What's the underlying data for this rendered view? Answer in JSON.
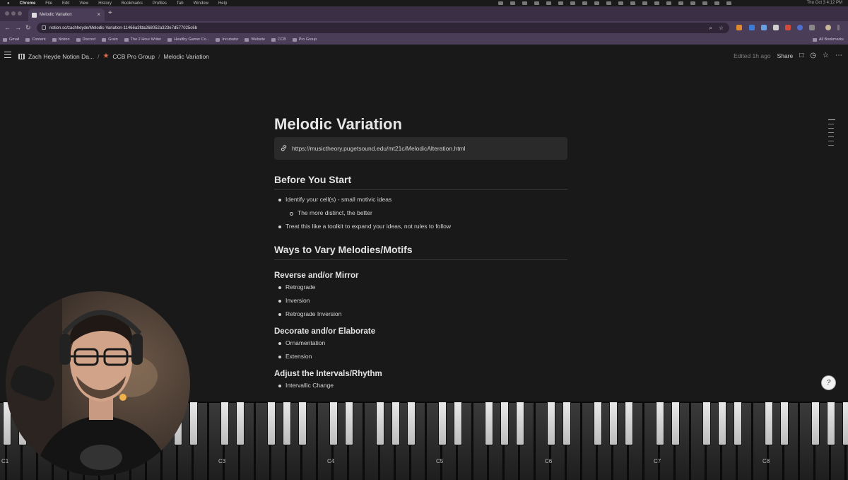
{
  "menubar": {
    "app": "Chrome",
    "items": [
      "File",
      "Edit",
      "View",
      "History",
      "Bookmarks",
      "Profiles",
      "Tab",
      "Window",
      "Help"
    ],
    "clock": "Thu Oct 3  4:12 PM"
  },
  "browser": {
    "tab_title": "Melodic Variation",
    "url": "notion.so/zachheyde/Melodic-Variation-11466a3fda268052a323e7d577025c6b",
    "bookmarks": [
      "Gmail",
      "Content",
      "Notion",
      "Discord",
      "Grain",
      "The 2 Hour Writer",
      "Healthy Gamer Co...",
      "Incubator",
      "Website",
      "CCB",
      "Pro Group"
    ],
    "all_bookmarks": "All Bookmarks"
  },
  "header": {
    "breadcrumbs": [
      "Zach Heyde Notion Da...",
      "CCB Pro Group",
      "Melodic Variation"
    ],
    "edited": "Edited 1h ago",
    "share": "Share"
  },
  "page": {
    "title": "Melodic Variation",
    "link": "https://musictheory.pugetsound.edu/mt21c/MelodicAlteration.html",
    "before_heading": "Before You Start",
    "before_items": [
      "Identify your cell(s) - small motivic ideas",
      "The more distinct, the better",
      "Treat this like a toolkit to expand your ideas, not rules to follow"
    ],
    "ways_heading": "Ways to Vary Melodies/Motifs",
    "sections": [
      {
        "heading": "Reverse and/or Mirror",
        "items": [
          "Retrograde",
          "Inversion",
          "Retrograde Inversion"
        ]
      },
      {
        "heading": "Decorate and/or Elaborate",
        "items": [
          "Ornamentation",
          "Extension"
        ]
      },
      {
        "heading": "Adjust the Intervals/Rhythm",
        "items": [
          "Intervallic Change"
        ]
      }
    ]
  },
  "piano": {
    "octave_labels": [
      "C1",
      "C3",
      "C4",
      "C5",
      "C6",
      "C7",
      "C8"
    ]
  },
  "help_label": "?"
}
